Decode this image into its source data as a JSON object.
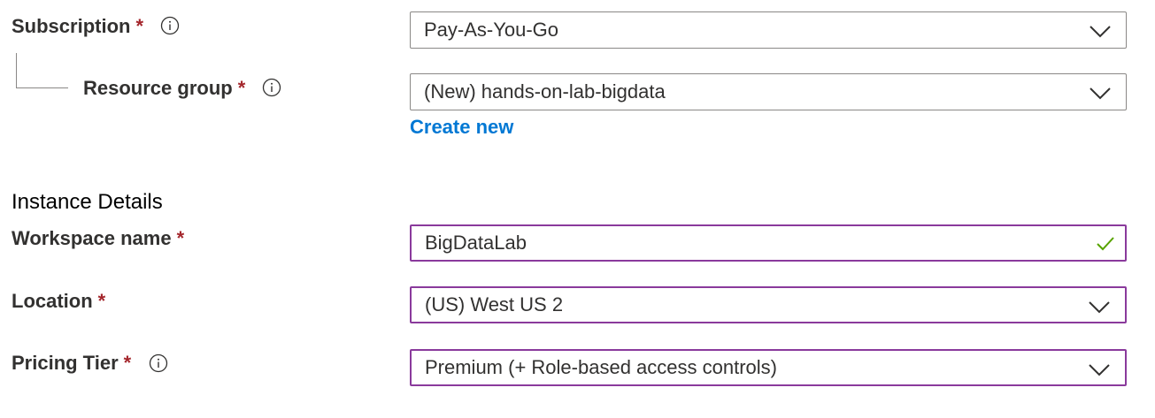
{
  "subscription": {
    "label": "Subscription",
    "required_mark": "*",
    "value": "Pay-As-You-Go"
  },
  "resource_group": {
    "label": "Resource group",
    "required_mark": "*",
    "value": "(New) hands-on-lab-bigdata",
    "create_new_link": "Create new"
  },
  "instance_details": {
    "heading": "Instance Details"
  },
  "workspace_name": {
    "label": "Workspace name",
    "required_mark": "*",
    "value": "BigDataLab",
    "status_icon": "checkmark-icon"
  },
  "location": {
    "label": "Location",
    "required_mark": "*",
    "value": "(US) West US 2"
  },
  "pricing_tier": {
    "label": "Pricing Tier",
    "required_mark": "*",
    "value": "Premium (+ Role-based access controls)"
  },
  "colors": {
    "required": "#a4262c",
    "link": "#0078d4",
    "focused_border": "#8a3a9c",
    "valid_check": "#57a300",
    "border": "#8a8886"
  }
}
